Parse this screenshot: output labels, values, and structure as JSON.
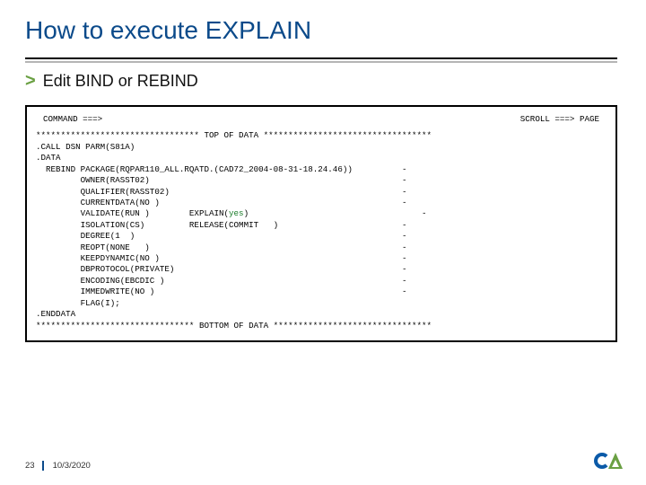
{
  "title": "How to execute EXPLAIN",
  "subtitle": "Edit BIND or REBIND",
  "chevron": ">",
  "terminal": {
    "command_label": "COMMAND ===>",
    "scroll_label": "SCROLL ===> PAGE",
    "top_rule": "********************************* TOP OF DATA **********************************",
    "line01": ".CALL DSN PARM(S81A)",
    "line02": ".DATA",
    "line03": "  REBIND PACKAGE(RQPAR110_ALL.RQATD.(CAD72_2004-08-31-18.24.46))          -",
    "line04": "         OWNER(RASST02)                                                   -",
    "line05": "         QUALIFIER(RASST02)                                               -",
    "line06": "         CURRENTDATA(NO )                                                 -",
    "line07a": "         VALIDATE(RUN )        EXPLAIN(",
    "line07b": "yes",
    "line07c": ")                                   -",
    "line08": "         ISOLATION(CS)         RELEASE(COMMIT   )                         -",
    "line09": "         DEGREE(1  )                                                      -",
    "line10": "         REOPT(NONE   )                                                   -",
    "line11": "         KEEPDYNAMIC(NO )                                                 -",
    "line12": "         DBPROTOCOL(PRIVATE)                                              -",
    "line13": "         ENCODING(EBCDIC )                                                -",
    "line14": "         IMMEDWRITE(NO )                                                  -",
    "line15": "         FLAG(I);",
    "line16": ".ENDDATA",
    "bottom_rule": "******************************** BOTTOM OF DATA ********************************"
  },
  "footer": {
    "page": "23",
    "date": "10/3/2020"
  }
}
